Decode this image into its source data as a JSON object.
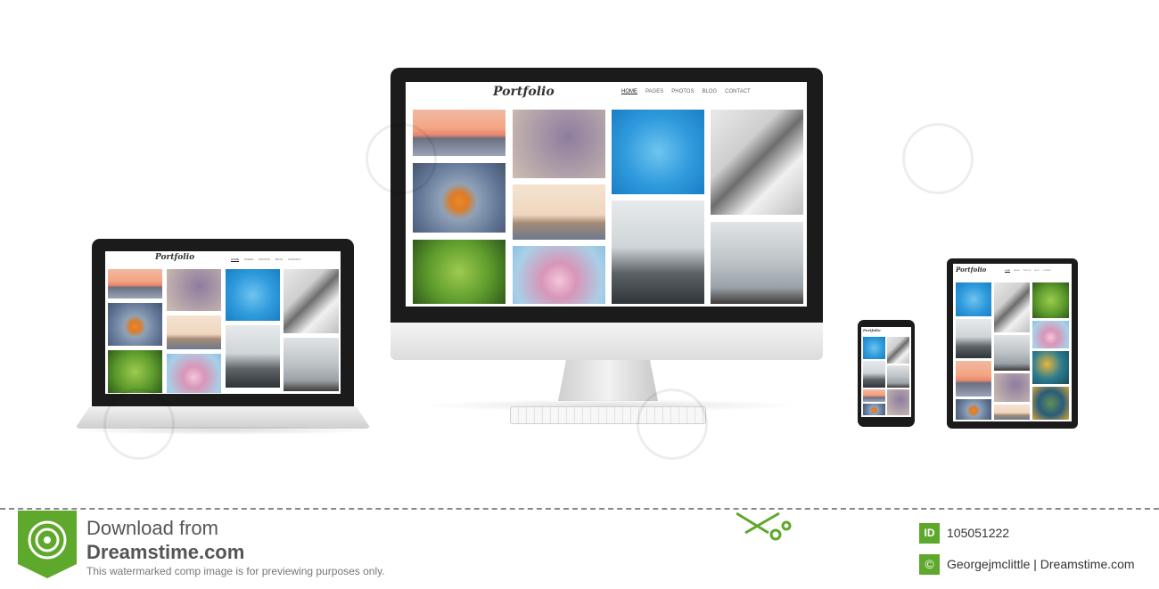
{
  "site": {
    "logo": "Portfolio",
    "nav": [
      "HOME",
      "PAGES",
      "PHOTOS",
      "BLOG",
      "CONTACT"
    ],
    "active_nav": "HOME"
  },
  "watermark": {
    "text": "dreamstime",
    "download_line1": "Download from",
    "download_line2": "Dreamstime.com",
    "disclaimer": "This watermarked comp image is for previewing purposes only.",
    "id_badge": "ID",
    "image_id": "105051222",
    "copyright_symbol": "©",
    "credit": "Georgejmclittle | Dreamstime.com"
  },
  "colors": {
    "brand_green": "#5ea82b",
    "device_black": "#1b1b1b",
    "device_silver": "#e8e8e8"
  },
  "icons": [
    "dreamstime-logo-icon",
    "scissors-icon",
    "id-badge-icon",
    "copyright-icon"
  ]
}
